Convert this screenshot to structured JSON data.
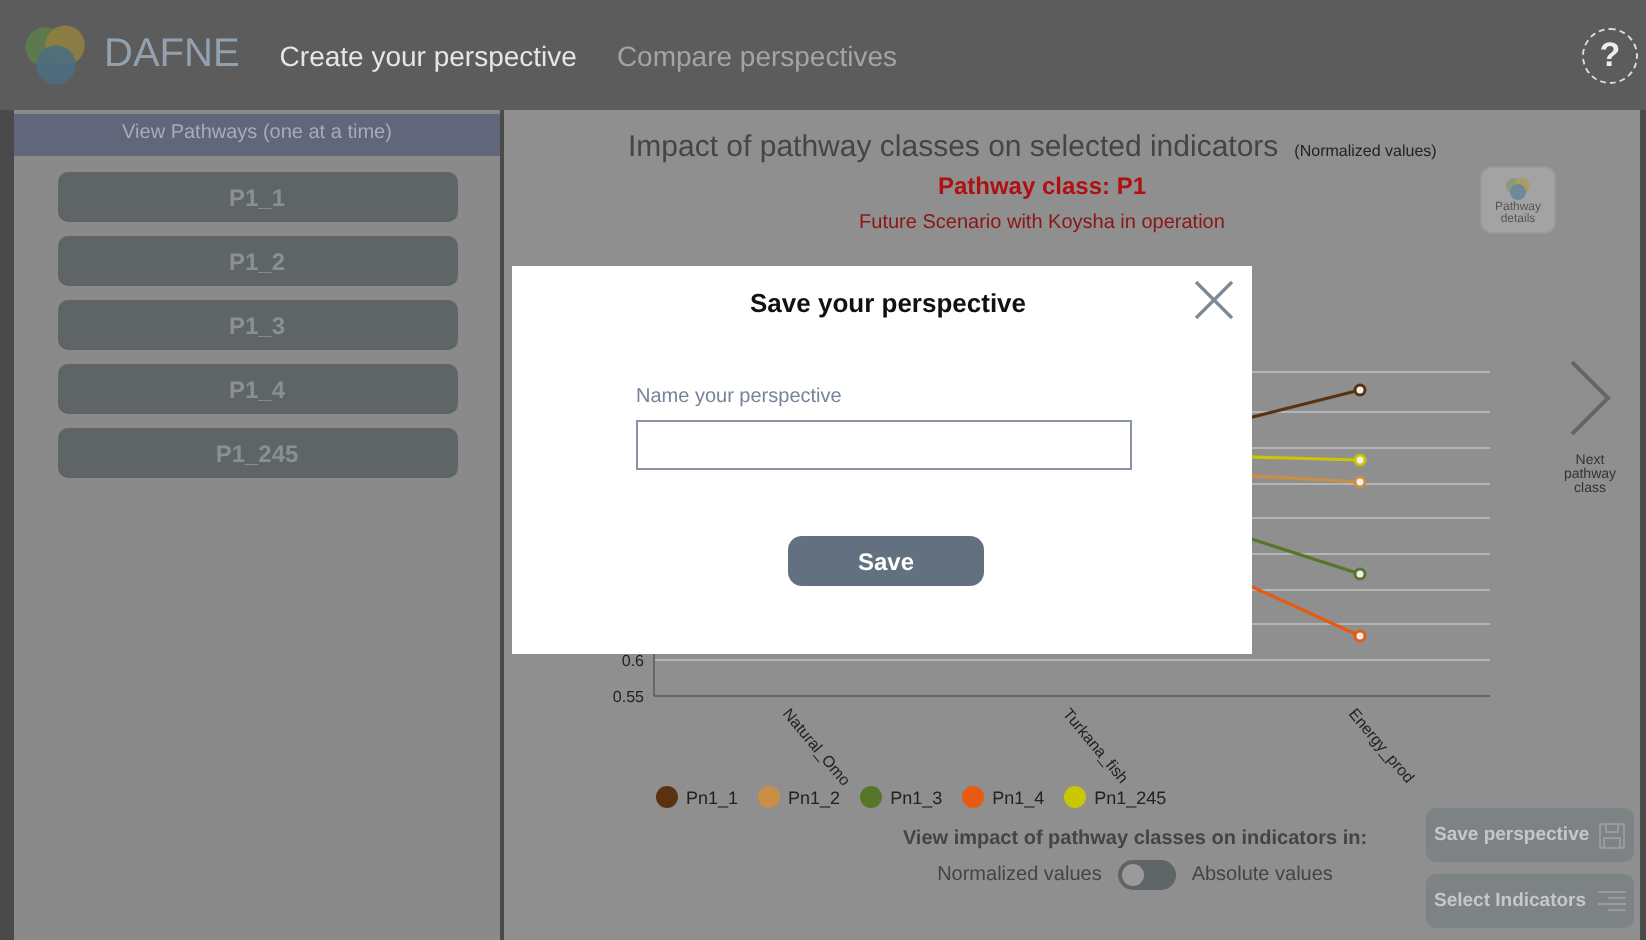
{
  "header": {
    "logo_text": "DAFNE",
    "tabs": [
      {
        "label": "Create your perspective",
        "selected": true
      },
      {
        "label": "Compare perspectives",
        "selected": false
      }
    ],
    "help": "?"
  },
  "sidebar": {
    "title": "View Pathways (one at a time)",
    "items": [
      {
        "label": "P1_1"
      },
      {
        "label": "P1_2"
      },
      {
        "label": "P1_3"
      },
      {
        "label": "P1_4"
      },
      {
        "label": "P1_245"
      }
    ]
  },
  "main": {
    "title": "Impact of pathway classes on selected indicators",
    "title_note": "(Normalized values)",
    "pathway_class": "Pathway class: P1",
    "scenario": "Future Scenario with Koysha in operation",
    "details_button": "Pathway details",
    "chart": {
      "y_tick_labels": [
        "0.6",
        "0.55"
      ],
      "categories": [
        "Natural_Omo",
        "Turkana_fish",
        "Energy_prod"
      ],
      "legend": [
        {
          "label": "Pn1_1",
          "color": "#5a3210"
        },
        {
          "label": "Pn1_2",
          "color": "#c98f45"
        },
        {
          "label": "Pn1_3",
          "color": "#56772a"
        },
        {
          "label": "Pn1_4",
          "color": "#e85a12"
        },
        {
          "label": "Pn1_245",
          "color": "#c9c800"
        }
      ]
    },
    "next_label": "Next pathway class",
    "units_prompt": "View impact of pathway classes on indicators in:",
    "toggle": {
      "left_label": "Normalized values",
      "right_label": "Absolute values",
      "on": false
    },
    "buttons": [
      {
        "label": "Save perspective",
        "kind": "save"
      },
      {
        "label": "Select Indicators",
        "kind": "list"
      }
    ]
  },
  "modal": {
    "title": "Save your perspective",
    "field_label": "Name your perspective",
    "button": "Save"
  }
}
